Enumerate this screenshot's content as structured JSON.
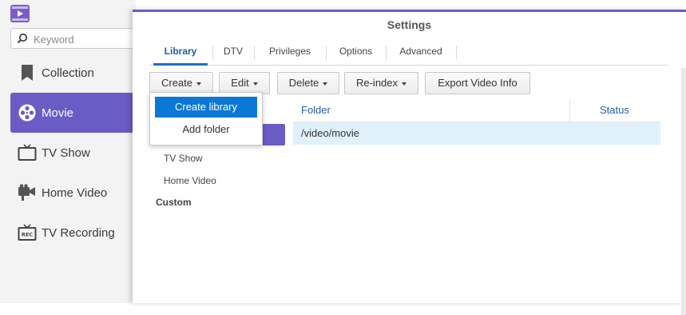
{
  "sidebar": {
    "search": {
      "placeholder": "Keyword",
      "value": ""
    },
    "items": [
      {
        "label": "Collection",
        "icon": "bookmark-icon"
      },
      {
        "label": "Movie",
        "icon": "film-reel-icon",
        "active": true
      },
      {
        "label": "TV Show",
        "icon": "tv-icon"
      },
      {
        "label": "Home Video",
        "icon": "camcorder-icon"
      },
      {
        "label": "TV Recording",
        "icon": "rec-tv-icon"
      }
    ]
  },
  "window": {
    "title": "Settings",
    "tabs": [
      {
        "label": "Library",
        "active": true
      },
      {
        "label": "DTV"
      },
      {
        "label": "Privileges"
      },
      {
        "label": "Options"
      },
      {
        "label": "Advanced"
      }
    ],
    "toolbar": {
      "create": "Create",
      "edit": "Edit",
      "delete": "Delete",
      "reindex": "Re-index",
      "export": "Export Video Info"
    },
    "create_menu": [
      "Create library",
      "Add folder"
    ],
    "libraries": {
      "items": [
        "TV Show",
        "Home Video"
      ],
      "custom_label": "Custom"
    },
    "folder_table": {
      "columns": [
        "Folder",
        "Status"
      ],
      "rows": [
        {
          "folder": "/video/movie",
          "status": ""
        }
      ]
    }
  },
  "colors": {
    "accent": "#6a5bc5",
    "menu_highlight": "#0c78d6",
    "selected_row": "#e1f1fb",
    "link_blue": "#1f5fa8"
  }
}
